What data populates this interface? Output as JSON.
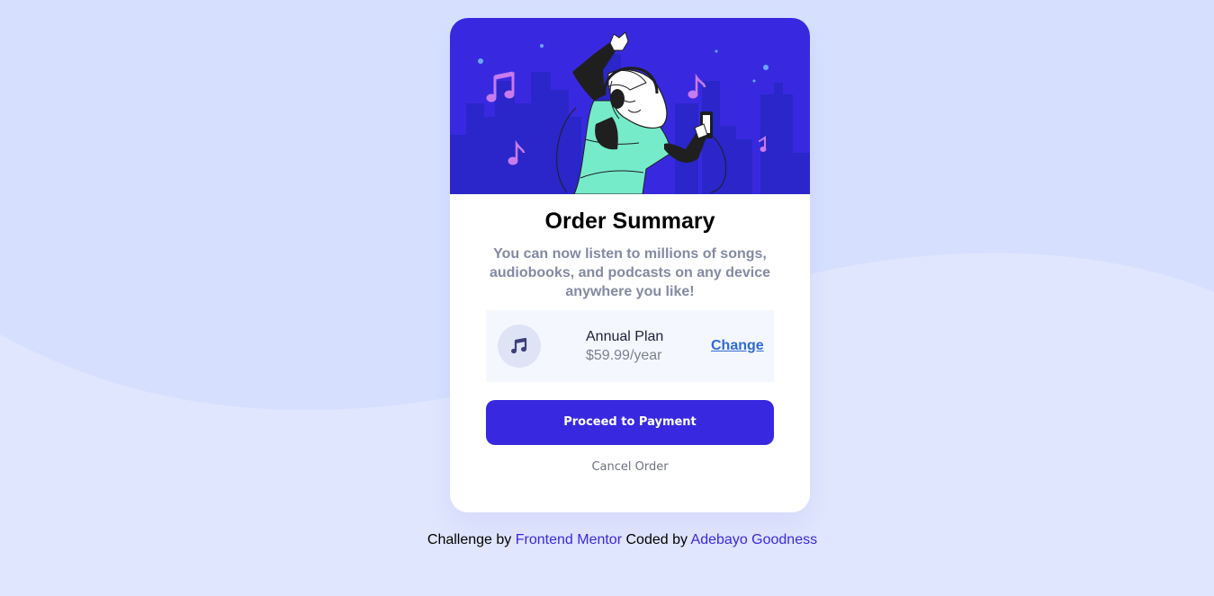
{
  "card": {
    "title": "Order Summary",
    "description": "You can now listen to millions of songs, audiobooks, and podcasts on any device anywhere you like!"
  },
  "plan": {
    "icon": "music-note-icon",
    "name": "Annual Plan",
    "price": "$59.99/year",
    "change_label": "Change"
  },
  "actions": {
    "proceed_label": "Proceed to Payment",
    "cancel_label": "Cancel Order"
  },
  "attribution": {
    "prefix": "Challenge by",
    "challenge_link": "Frontend Mentor",
    "middle": "Coded by",
    "author_link": "Adebayo Goodness"
  },
  "colors": {
    "page_background": "#e0e6fd",
    "wave": "#d6e0fe",
    "hero_background": "#3829e0",
    "primary": "#3829e0",
    "link": "#2f6ad6",
    "muted_text": "#8489a3",
    "plan_box": "#f5f7ff",
    "illustration_shirt": "#76ebc9",
    "music_notes": "#c77bee"
  }
}
